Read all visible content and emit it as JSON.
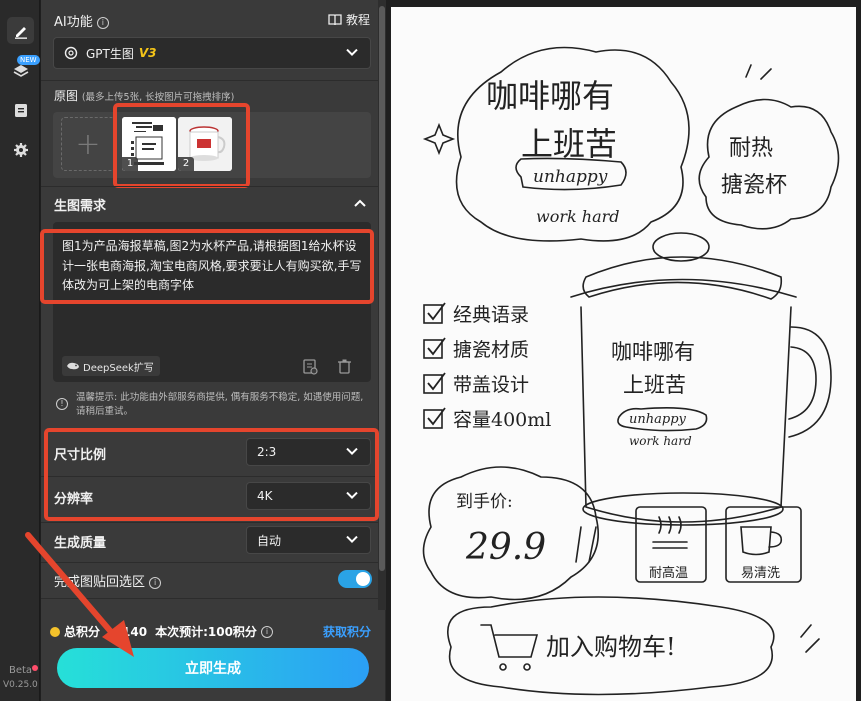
{
  "rail": {
    "new_badge": "NEW",
    "beta": "Beta",
    "version": "V0.25.0"
  },
  "header": {
    "title": "AI功能",
    "tutorial": "教程"
  },
  "model": {
    "name": "GPT生图",
    "version": "V3"
  },
  "source_images": {
    "label": "原图",
    "hint": "(最多上传5张, 长按图片可拖拽排序)",
    "slot_numbers": [
      "1",
      "2"
    ]
  },
  "prompt": {
    "section_label": "生图需求",
    "text": "图1为产品海报草稿,图2为水杯产品,请根据图1给水杯设计一张电商海报,淘宝电商风格,要求要让人有购买欲,手写体改为可上架的电商字体",
    "deepseek_label": "DeepSeek扩写"
  },
  "tip": "温馨提示: 此功能由外部服务商提供, 偶有服务不稳定, 如遇使用问题, 请稍后重试。",
  "settings": {
    "aspect": {
      "label": "尺寸比例",
      "value": "2:3"
    },
    "resolution": {
      "label": "分辨率",
      "value": "4K"
    },
    "quality": {
      "label": "生成质量",
      "value": "自动"
    },
    "paste_back": {
      "label": "完成图贴回选区",
      "enabled": true
    }
  },
  "footer": {
    "points_label": "总积分",
    "points_value": "140",
    "estimate": "本次预计:100积分",
    "get_points": "获取积分",
    "generate": "立即生成"
  },
  "preview": {
    "title_line1": "咖啡哪有",
    "title_line2": "上班苦",
    "sub1": "unhappy",
    "sub2": "work hard",
    "cloud_line1": "耐热",
    "cloud_line2": "搪瓷杯",
    "features": [
      "经典语录",
      "搪瓷材质",
      "带盖设计",
      "容量400ml"
    ],
    "cup_line1": "咖啡哪有",
    "cup_line2": "上班苦",
    "cup_sub1": "unhappy",
    "cup_sub2": "work hard",
    "price_label": "到手价:",
    "price": "29.9",
    "badge1": "耐高温",
    "badge2": "易清洗",
    "cart": "加入购物车!"
  }
}
